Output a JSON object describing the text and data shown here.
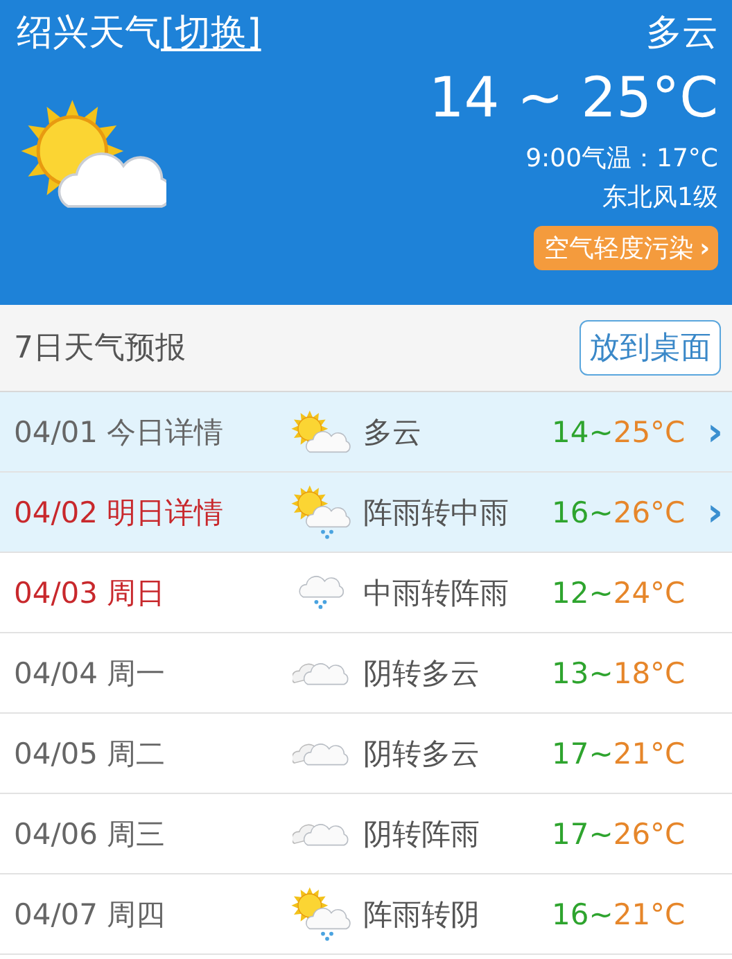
{
  "header": {
    "city_title": "绍兴天气",
    "switch_link": "[切换]",
    "condition": "多云",
    "temp_range": "14 ~ 25°C",
    "current_temp": "9:00气温：17°C",
    "wind": "东北风1级",
    "air_quality": "空气轻度污染",
    "air_arrow": "›",
    "kind": "sun_cloud"
  },
  "forecast": {
    "title": "7日天气预报",
    "pin_button": "放到桌面",
    "rows": [
      {
        "date": "04/01 今日详情",
        "kind": "sun_cloud",
        "weather": "多云",
        "low": "14~",
        "high": "25°C",
        "highlighted": true,
        "red": false,
        "chevron": "›"
      },
      {
        "date": "04/02 明日详情",
        "kind": "sun_cloud_rain",
        "weather": "阵雨转中雨",
        "low": "16~",
        "high": "26°C",
        "highlighted": true,
        "red": true,
        "chevron": "›"
      },
      {
        "date": "04/03 周日",
        "kind": "rain",
        "weather": "中雨转阵雨",
        "low": "12~",
        "high": "24°C",
        "highlighted": false,
        "red": true
      },
      {
        "date": "04/04 周一",
        "kind": "cloudy",
        "weather": "阴转多云",
        "low": "13~",
        "high": "18°C",
        "highlighted": false,
        "red": false
      },
      {
        "date": "04/05 周二",
        "kind": "cloudy",
        "weather": "阴转多云",
        "low": "17~",
        "high": "21°C",
        "highlighted": false,
        "red": false
      },
      {
        "date": "04/06 周三",
        "kind": "cloudy",
        "weather": "阴转阵雨",
        "low": "17~",
        "high": "26°C",
        "highlighted": false,
        "red": false
      },
      {
        "date": "04/07 周四",
        "kind": "sun_cloud_rain",
        "weather": "阵雨转阴",
        "low": "16~",
        "high": "21°C",
        "highlighted": false,
        "red": false
      }
    ]
  }
}
